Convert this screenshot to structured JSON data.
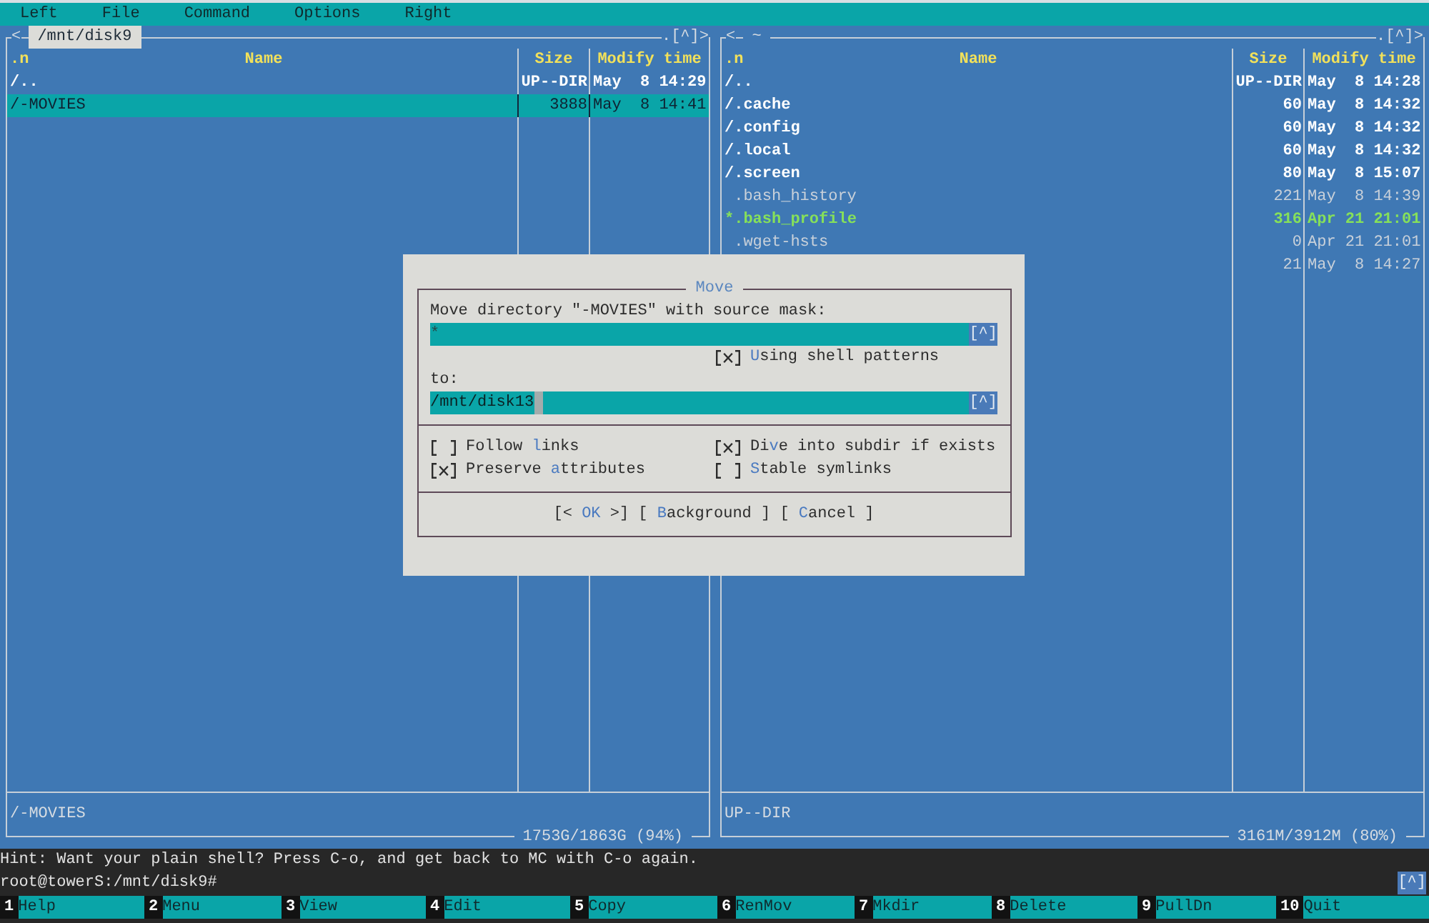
{
  "menu_bar": [
    "Left",
    "File",
    "Command",
    "Options",
    "Right"
  ],
  "panels": [
    {
      "active": true,
      "history_button": "<",
      "path": "/mnt/disk9",
      "panel_buttons": ".[^]>",
      "sort_indicator": ".n",
      "columns": [
        "Name",
        "Size",
        "Modify time"
      ],
      "files": [
        {
          "name": "/..",
          "size": "UP--DIR",
          "modified": "May  8 14:29",
          "kind": "updir",
          "selected": false
        },
        {
          "name": "/-MOVIES",
          "size": "3888",
          "modified": "May  8 14:41",
          "kind": "directory",
          "selected": true
        }
      ],
      "mini_status": "/-MOVIES",
      "disk_usage": "1753G/1863G (94%)"
    },
    {
      "active": false,
      "history_button": "<",
      "path": "~",
      "panel_buttons": ".[^]>",
      "sort_indicator": ".n",
      "columns": [
        "Name",
        "Size",
        "Modify time"
      ],
      "files": [
        {
          "name": "/..",
          "size": "UP--DIR",
          "modified": "May  8 14:28",
          "kind": "updir",
          "selected": false
        },
        {
          "name": "/.cache",
          "size": "60",
          "modified": "May  8 14:32",
          "kind": "directory",
          "selected": false
        },
        {
          "name": "/.config",
          "size": "60",
          "modified": "May  8 14:32",
          "kind": "directory",
          "selected": false
        },
        {
          "name": "/.local",
          "size": "60",
          "modified": "May  8 14:32",
          "kind": "directory",
          "selected": false
        },
        {
          "name": "/.screen",
          "size": "80",
          "modified": "May  8 15:07",
          "kind": "directory",
          "selected": false
        },
        {
          "name": ".bash_history",
          "size": "221",
          "modified": "May  8 14:39",
          "kind": "file",
          "selected": false
        },
        {
          "name": "*.bash_profile",
          "size": "316",
          "modified": "Apr 21 21:01",
          "kind": "executable",
          "selected": false
        },
        {
          "name": ".wget-hsts",
          "size": "0",
          "modified": "Apr 21 21:01",
          "kind": "file",
          "selected": false
        },
        {
          "size": "21",
          "modified": "May  8 14:27",
          "kind": "file",
          "selected": false
        }
      ],
      "mini_status": "UP--DIR",
      "disk_usage": "3161M/3912M (80%)"
    }
  ],
  "dialog": {
    "title": "Move",
    "source_label": "Move directory \"-MOVIES\" with source mask:",
    "source_field": {
      "value": "*",
      "history_button": "[^]",
      "focused": false
    },
    "shell_patterns": {
      "checked": true,
      "label": {
        "hotkey": "U",
        "post": "sing shell patterns"
      }
    },
    "target_label": "to:",
    "target_field": {
      "value": "/mnt/disk13",
      "history_button": "[^]",
      "focused": true
    },
    "options": [
      {
        "checked": false,
        "label": {
          "pre": "Follow ",
          "hotkey": "l",
          "post": "inks"
        }
      },
      {
        "checked": true,
        "label": {
          "pre": "Di",
          "hotkey": "v",
          "post": "e into subdir if exists"
        }
      },
      {
        "checked": true,
        "label": {
          "pre": "Preserve ",
          "hotkey": "a",
          "post": "ttributes"
        }
      },
      {
        "checked": false,
        "label": {
          "hotkey": "S",
          "post": "table symlinks"
        }
      }
    ],
    "buttons": [
      {
        "pre": "[< ",
        "hotkey": "OK",
        "post": " >]"
      },
      {
        "pre": "[ ",
        "hotkey": "B",
        "post": "ackground ]"
      },
      {
        "pre": "[ ",
        "hotkey": "C",
        "post": "ancel ]"
      }
    ]
  },
  "hint": "Hint: Want your plain shell? Press C-o, and get back to MC with C-o again.",
  "command_line": {
    "prompt": "root@towerS:/mnt/disk9#",
    "history_button": "[^]"
  },
  "function_keys": [
    {
      "number": "1",
      "label": "Help"
    },
    {
      "number": "2",
      "label": "Menu"
    },
    {
      "number": "3",
      "label": "View"
    },
    {
      "number": "4",
      "label": "Edit"
    },
    {
      "number": "5",
      "label": "Copy"
    },
    {
      "number": "6",
      "label": "RenMov"
    },
    {
      "number": "7",
      "label": "Mkdir"
    },
    {
      "number": "8",
      "label": "Delete"
    },
    {
      "number": "9",
      "label": "PullDn"
    },
    {
      "number": "10",
      "label": "Quit"
    }
  ]
}
